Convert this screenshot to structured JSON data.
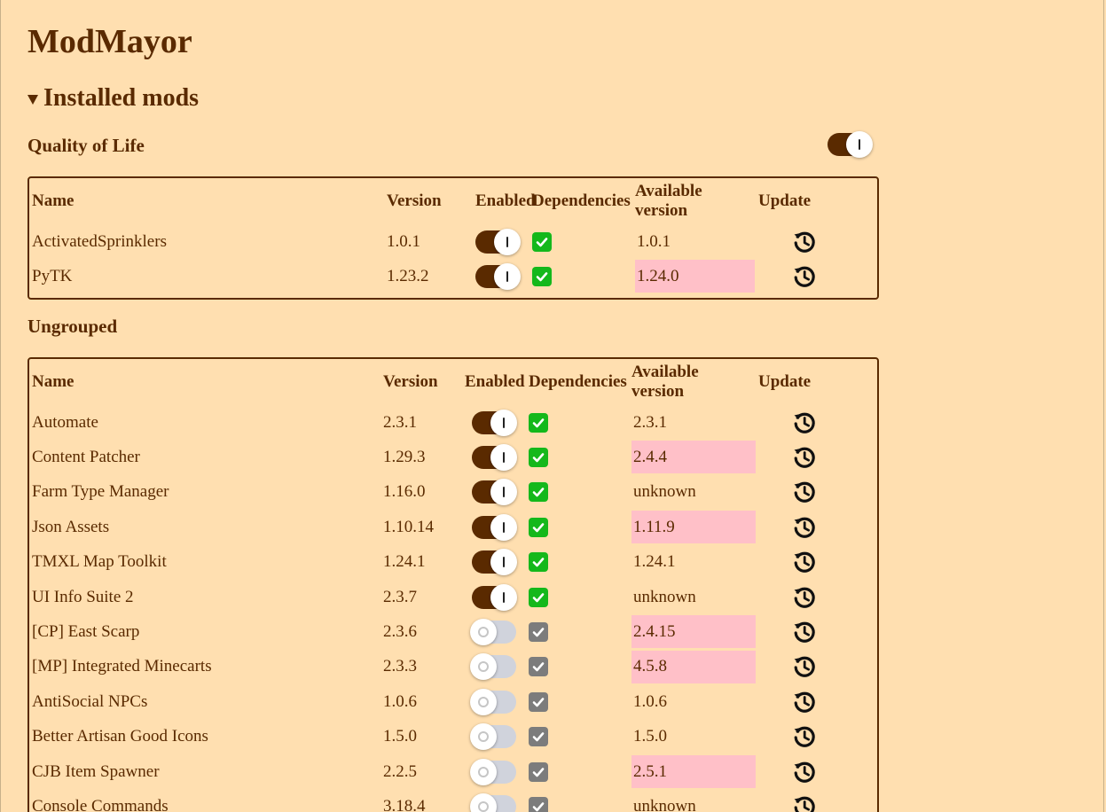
{
  "app": {
    "title": "ModMayor"
  },
  "installed": {
    "heading": "Installed mods"
  },
  "columns": {
    "name": "Name",
    "version": "Version",
    "enabled": "Enabled",
    "dependencies": "Dependencies",
    "available": "Available version",
    "update": "Update"
  },
  "groups": [
    {
      "title": "Quality of Life",
      "enabled": true,
      "mods": [
        {
          "name": "ActivatedSprinklers",
          "version": "1.0.1",
          "enabled": true,
          "deps_ok": true,
          "available": "1.0.1",
          "outdated": false
        },
        {
          "name": "PyTK",
          "version": "1.23.2",
          "enabled": true,
          "deps_ok": true,
          "available": "1.24.0",
          "outdated": true
        }
      ]
    },
    {
      "title": "Ungrouped",
      "enabled": null,
      "mods": [
        {
          "name": "Automate",
          "version": "2.3.1",
          "enabled": true,
          "deps_ok": true,
          "available": "2.3.1",
          "outdated": false
        },
        {
          "name": "Content Patcher",
          "version": "1.29.3",
          "enabled": true,
          "deps_ok": true,
          "available": "2.4.4",
          "outdated": true
        },
        {
          "name": "Farm Type Manager",
          "version": "1.16.0",
          "enabled": true,
          "deps_ok": true,
          "available": "unknown",
          "outdated": false
        },
        {
          "name": "Json Assets",
          "version": "1.10.14",
          "enabled": true,
          "deps_ok": true,
          "available": "1.11.9",
          "outdated": true
        },
        {
          "name": "TMXL Map Toolkit",
          "version": "1.24.1",
          "enabled": true,
          "deps_ok": true,
          "available": "1.24.1",
          "outdated": false
        },
        {
          "name": "UI Info Suite 2",
          "version": "2.3.7",
          "enabled": true,
          "deps_ok": true,
          "available": "unknown",
          "outdated": false
        },
        {
          "name": "[CP] East Scarp",
          "version": "2.3.6",
          "enabled": false,
          "deps_ok": false,
          "available": "2.4.15",
          "outdated": true
        },
        {
          "name": "[MP] Integrated Minecarts",
          "version": "2.3.3",
          "enabled": false,
          "deps_ok": false,
          "available": "4.5.8",
          "outdated": true
        },
        {
          "name": "AntiSocial NPCs",
          "version": "1.0.6",
          "enabled": false,
          "deps_ok": false,
          "available": "1.0.6",
          "outdated": false
        },
        {
          "name": "Better Artisan Good Icons",
          "version": "1.5.0",
          "enabled": false,
          "deps_ok": false,
          "available": "1.5.0",
          "outdated": false
        },
        {
          "name": "CJB Item Spawner",
          "version": "2.2.5",
          "enabled": false,
          "deps_ok": false,
          "available": "2.5.1",
          "outdated": true
        },
        {
          "name": "Console Commands",
          "version": "3.18.4",
          "enabled": false,
          "deps_ok": false,
          "available": "unknown",
          "outdated": false
        }
      ]
    }
  ],
  "colors": {
    "background": "#ffdfb0",
    "text": "#5a2a00",
    "outdated_highlight": "#ffc0c8",
    "deps_ok": "#14b81b",
    "deps_unavailable": "#7c7c7c",
    "toggle_on": "#5a2a00",
    "toggle_off": "#d0d3dc"
  },
  "icons": {
    "collapse": "triangle-down-icon",
    "update": "history-clock-icon",
    "deps_ok": "check-box-icon"
  }
}
